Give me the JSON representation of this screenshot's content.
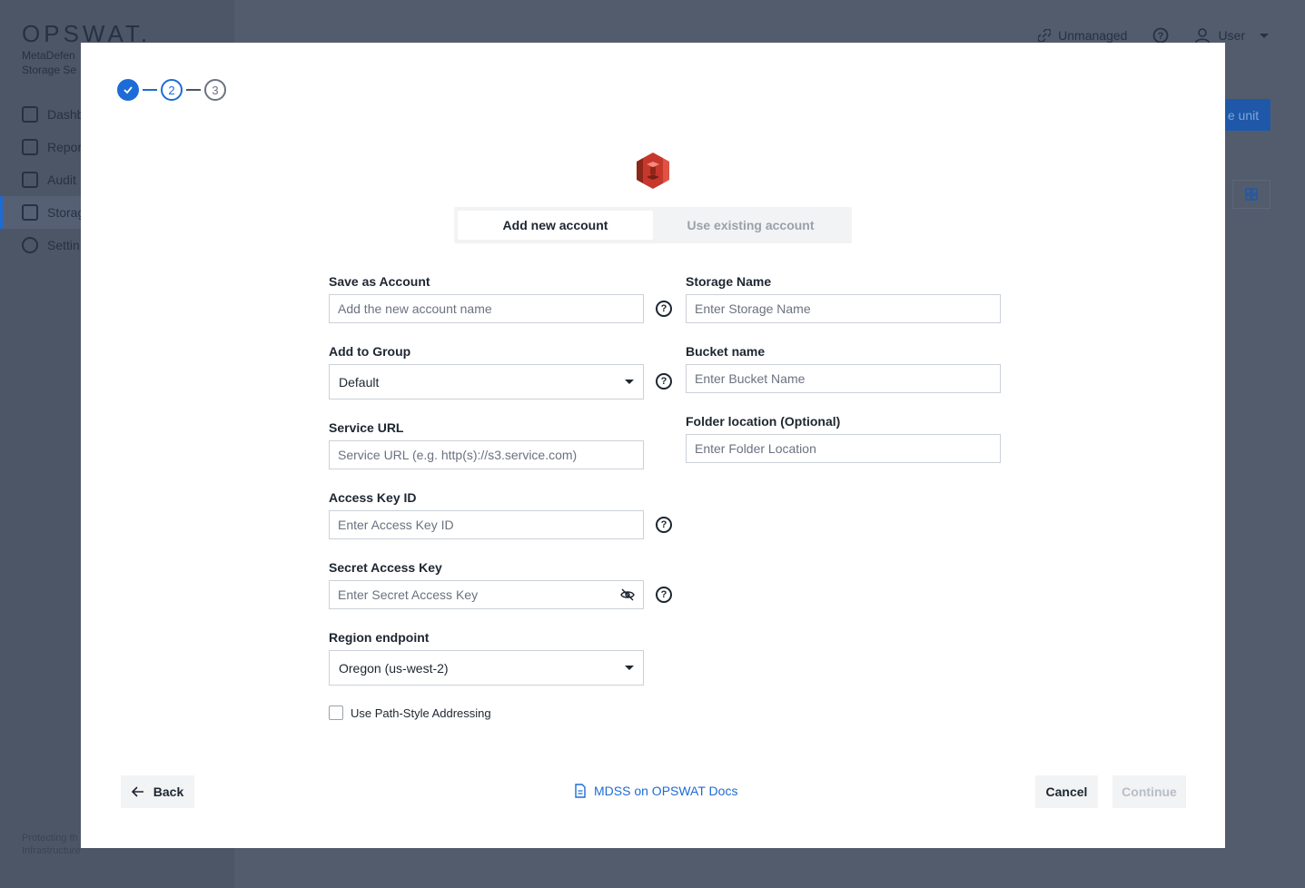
{
  "background": {
    "brand": "OPSWAT.",
    "product_line1": "MetaDefen",
    "product_line2": "Storage Se",
    "nav": [
      "Dashb",
      "Repor",
      "Audit",
      "Storag",
      "Settin"
    ],
    "footer_line1": "Protecting th",
    "footer_line2": "Infrastructure",
    "unmanaged": "Unmanaged",
    "user": "User",
    "action_button": "e unit"
  },
  "stepper": {
    "step2": "2",
    "step3": "3"
  },
  "tabs": {
    "add_new": "Add new account",
    "use_existing": "Use existing account"
  },
  "form": {
    "save_as_account": {
      "label": "Save as Account",
      "placeholder": "Add the new account name"
    },
    "add_to_group": {
      "label": "Add to Group",
      "value": "Default"
    },
    "service_url": {
      "label": "Service URL",
      "placeholder": "Service URL (e.g. http(s)://s3.service.com)"
    },
    "access_key_id": {
      "label": "Access Key ID",
      "placeholder": "Enter Access Key ID"
    },
    "secret_access_key": {
      "label": "Secret Access Key",
      "placeholder": "Enter Secret Access Key"
    },
    "region_endpoint": {
      "label": "Region endpoint",
      "value": "Oregon (us-west-2)"
    },
    "storage_name": {
      "label": "Storage Name",
      "placeholder": "Enter Storage Name"
    },
    "bucket_name": {
      "label": "Bucket name",
      "placeholder": "Enter Bucket Name"
    },
    "folder_location": {
      "label": "Folder location (Optional)",
      "placeholder": "Enter Folder Location"
    },
    "path_style": {
      "label": "Use Path-Style Addressing",
      "checked": false
    }
  },
  "footer": {
    "back": "Back",
    "docs_link": "MDSS on OPSWAT Docs",
    "cancel": "Cancel",
    "continue": "Continue"
  },
  "colors": {
    "accent": "#1d6bd6",
    "s3_red": "#c7372b"
  }
}
